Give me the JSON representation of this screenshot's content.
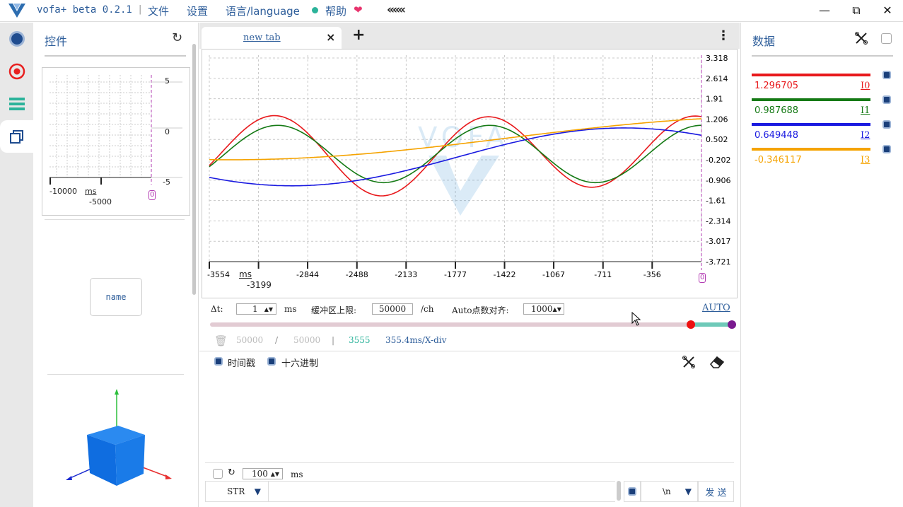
{
  "titlebar": {
    "app_title": "vofa+ beta 0.2.1",
    "menus": [
      "文件",
      "设置",
      "语言/language",
      "帮助"
    ],
    "collapse_icon": "«««",
    "minimize": "—",
    "restore": "⧉",
    "close": "✕",
    "brand_color": "#2d5d9a"
  },
  "leftrail": {
    "tabs": [
      "record-icon",
      "target-icon",
      "list-icon",
      "widgets-icon"
    ]
  },
  "controls": {
    "header": "控件",
    "refresh_icon": "↻",
    "mini_chart": {
      "y_ticks": [
        "5",
        "0",
        "-5"
      ],
      "x_ticks": [
        "-10000",
        "-5000"
      ],
      "unit": "ms",
      "cursor": "0"
    },
    "name_widget": "name"
  },
  "tabs": {
    "active": "new tab",
    "close": "×",
    "add": "+",
    "more": "⋮"
  },
  "chart": {
    "watermark": "VOFA",
    "y_ticks": [
      "3.318",
      "2.614",
      "1.91",
      "1.206",
      "0.502",
      "-0.202",
      "-0.906",
      "-1.61",
      "-2.314",
      "-3.017",
      "-3.721"
    ],
    "x_ticks_top": [
      "-3554",
      "-2844",
      "-2488",
      "-2133",
      "-1777",
      "-1422",
      "-1067",
      "-711",
      "-356"
    ],
    "x_tick_sub": "-3199",
    "x_unit": "ms",
    "cursor_label": "0"
  },
  "chart_data": {
    "type": "line",
    "x_range": [
      -3554,
      0
    ],
    "ylim": [
      -3.721,
      3.318
    ],
    "series": [
      {
        "name": "I0",
        "color": "#e8191c",
        "last": 1.296705
      },
      {
        "name": "I1",
        "color": "#157a15",
        "last": 0.987688
      },
      {
        "name": "I2",
        "color": "#1a1ae0",
        "last": 0.649448
      },
      {
        "name": "I3",
        "color": "#f5a300",
        "last": -0.346117
      }
    ]
  },
  "toolbar": {
    "dt_label": "Δt:",
    "dt_value": "1",
    "dt_unit": "ms",
    "buffer_label": "缓冲区上限:",
    "buffer_value": "50000",
    "buffer_unit": "/ch",
    "auto_align_label": "Auto点数对齐:",
    "auto_align_value": "1000",
    "auto_link": "AUTO"
  },
  "stats": {
    "count1": "50000",
    "slash": "/",
    "count2": "50000",
    "bar": "|",
    "points": "3555",
    "xdiv": "355.4ms/X-div"
  },
  "terminal": {
    "timestamp_label": "时间戳",
    "hex_label": "十六进制",
    "interval_value": "100",
    "interval_unit": "ms",
    "mode": "STR",
    "eol": "\\n",
    "send": "发 送"
  },
  "data_panel": {
    "header": "数据",
    "channels": [
      {
        "value": "1.296705",
        "name": "I0",
        "color": "#e8191c"
      },
      {
        "value": "0.987688",
        "name": "I1",
        "color": "#157a15"
      },
      {
        "value": "0.649448",
        "name": "I2",
        "color": "#1a1ae0"
      },
      {
        "value": "-0.346117",
        "name": "I3",
        "color": "#f5a300"
      }
    ]
  }
}
